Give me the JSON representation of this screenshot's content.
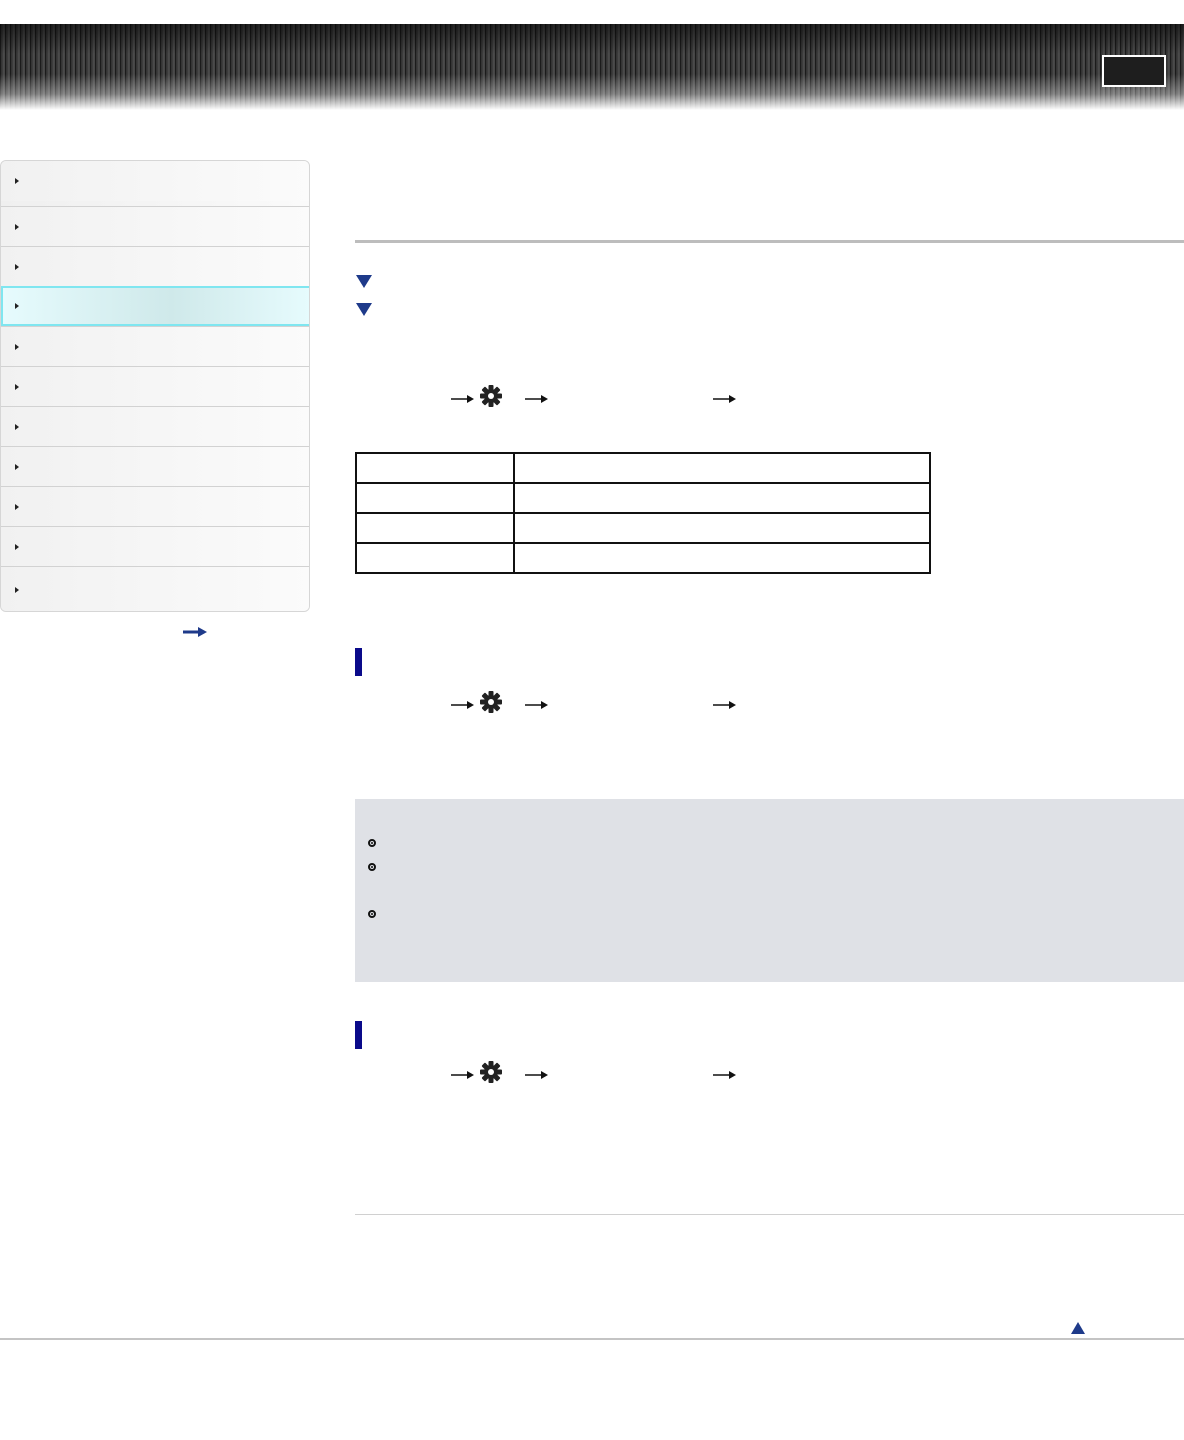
{
  "header": {
    "button_label": ""
  },
  "sidebar": {
    "items": [
      {
        "label": ""
      },
      {
        "label": ""
      },
      {
        "label": ""
      },
      {
        "label": ""
      },
      {
        "label": ""
      },
      {
        "label": ""
      },
      {
        "label": ""
      },
      {
        "label": ""
      },
      {
        "label": ""
      },
      {
        "label": ""
      },
      {
        "label": ""
      }
    ],
    "active_index": 3,
    "more_icon": "arrow-right-icon"
  },
  "content": {
    "jump_icons": [
      "triangle-down-icon",
      "triangle-down-icon"
    ],
    "menu_path_icons": [
      "arrow-right-icon",
      "gear-icon",
      "arrow-right-icon",
      "arrow-right-icon"
    ],
    "table": {
      "rows": [
        [
          "",
          ""
        ],
        [
          "",
          ""
        ],
        [
          "",
          ""
        ],
        [
          "",
          ""
        ]
      ]
    },
    "note_bullets": 3,
    "back_to_top_icon": "triangle-up-icon"
  },
  "colors": {
    "accent": "#1e3a8a",
    "section_bar": "#0a0a8a",
    "note_bg": "#dfe1e6",
    "active_item_border": "#7fe6f0"
  }
}
